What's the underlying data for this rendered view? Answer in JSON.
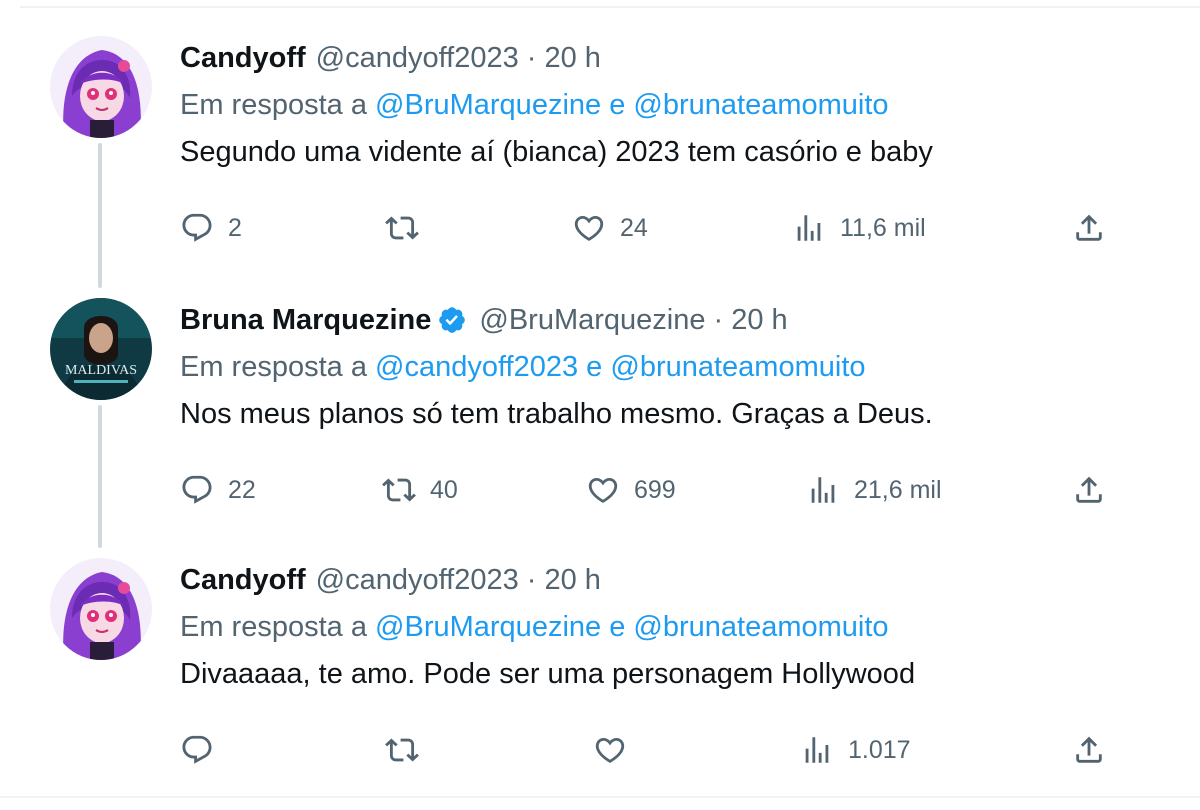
{
  "colors": {
    "accent": "#1d9bf0",
    "secondary_text": "#536471",
    "primary_text": "#0f1419",
    "thread_line": "#cfd9de"
  },
  "tweets": [
    {
      "author_name": "Candyoff",
      "handle": "@candyoff2023",
      "time": "· 20 h",
      "verified": false,
      "reply_prefix": "Em resposta a",
      "reply_mention_1": "@BruMarquezine",
      "reply_joiner": "e",
      "reply_mention_2": "@brunateamomuito",
      "text": "Segundo uma vidente aí (bianca) 2023 tem casório e baby",
      "replies": "2",
      "retweets": "",
      "likes": "24",
      "views": "11,6 mil"
    },
    {
      "author_name": "Bruna Marquezine",
      "handle": "@BruMarquezine",
      "time": "· 20 h",
      "verified": true,
      "avatar_text": "MALDIVAS",
      "reply_prefix": "Em resposta a",
      "reply_mention_1": "@candyoff2023",
      "reply_joiner": "e",
      "reply_mention_2": "@brunateamomuito",
      "text": "Nos meus planos só tem trabalho mesmo. Graças a Deus.",
      "replies": "22",
      "retweets": "40",
      "likes": "699",
      "views": "21,6 mil"
    },
    {
      "author_name": "Candyoff",
      "handle": "@candyoff2023",
      "time": "· 20 h",
      "verified": false,
      "reply_prefix": "Em resposta a",
      "reply_mention_1": "@BruMarquezine",
      "reply_joiner": "e",
      "reply_mention_2": "@brunateamomuito",
      "text": "Divaaaaa, te amo. Pode ser uma personagem Hollywood",
      "replies": "",
      "retweets": "",
      "likes": "",
      "views": "1.017"
    }
  ]
}
